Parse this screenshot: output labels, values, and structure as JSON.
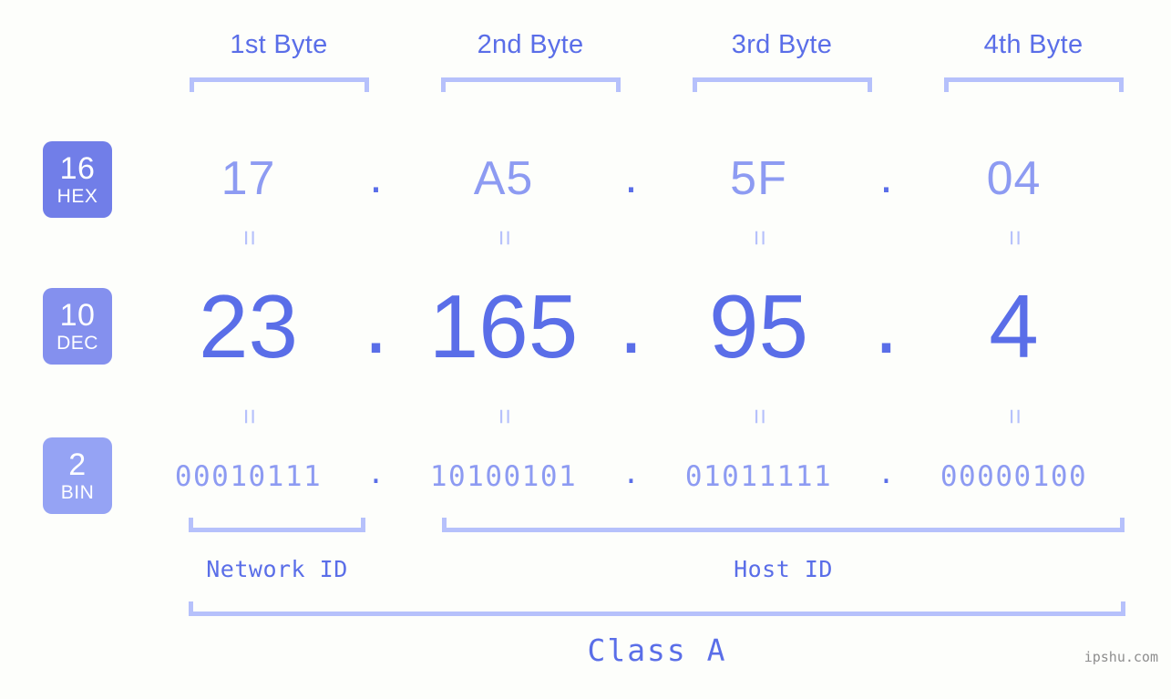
{
  "meta": {
    "background_color": "#fdfefb",
    "accent_strong": "#5a6ee8",
    "accent_mid": "#8d9bf2",
    "accent_light": "#b6c1fb",
    "watermark": "ipshu.com"
  },
  "byte_headers": [
    {
      "label": "1st Byte"
    },
    {
      "label": "2nd Byte"
    },
    {
      "label": "3rd Byte"
    },
    {
      "label": "4th Byte"
    }
  ],
  "bases": [
    {
      "number": "16",
      "abbr": "HEX",
      "color": "#717ee8"
    },
    {
      "number": "10",
      "abbr": "DEC",
      "color": "#8490ee"
    },
    {
      "number": "2",
      "abbr": "BIN",
      "color": "#95a3f4"
    }
  ],
  "rows": {
    "hex": {
      "base_number": "16",
      "base_abbr": "HEX",
      "separator": ".",
      "values": [
        "17",
        "A5",
        "5F",
        "04"
      ]
    },
    "dec": {
      "base_number": "10",
      "base_abbr": "DEC",
      "separator": ".",
      "values": [
        "23",
        "165",
        "95",
        "4"
      ]
    },
    "bin": {
      "base_number": "2",
      "base_abbr": "BIN",
      "separator": ".",
      "values": [
        "00010111",
        "10100101",
        "01011111",
        "00000100"
      ]
    }
  },
  "equality_marks": {
    "glyph": "=",
    "count_per_row": 4
  },
  "id_sections": [
    {
      "label": "Network ID"
    },
    {
      "label": "Host ID"
    }
  ],
  "class_label": "Class A"
}
